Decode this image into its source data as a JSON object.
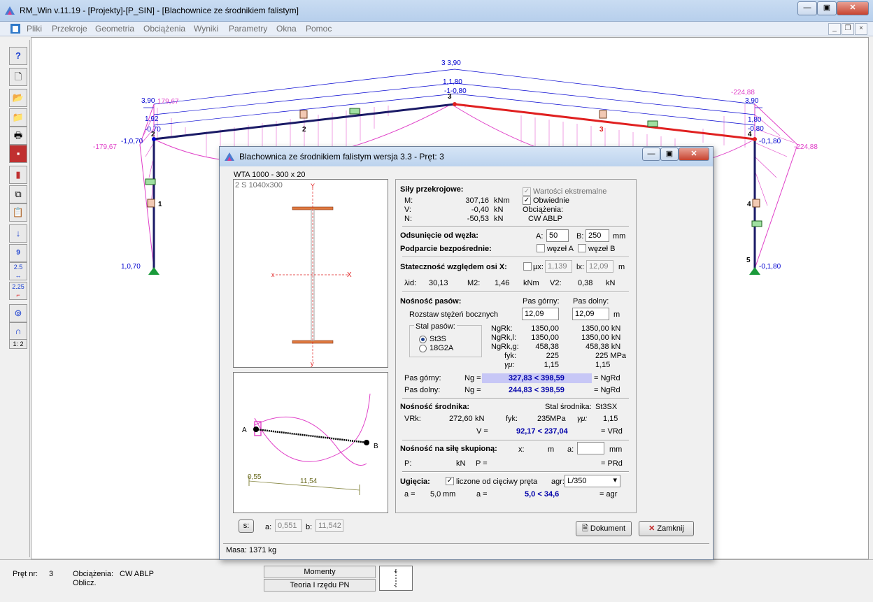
{
  "window": {
    "title": "RM_Win v.11.19 - [Projekty]-[P_SIN] - [Blachownice ze środnikiem falistym]"
  },
  "menu": [
    "Pliki",
    "Przekroje",
    "Geometria",
    "Obciążenia",
    "Wyniki",
    "Parametry",
    "Okna",
    "Pomoc"
  ],
  "toolbar": {
    "icons": [
      "help-icon",
      "new-file-icon",
      "open-folder-icon",
      "open-project-icon",
      "print-icon",
      "save-icon",
      "paint-icon",
      "copy-icon",
      "paste-icon",
      "load-arrow-icon",
      "number-icon",
      "dimension-icon",
      "scale-icon",
      "node-icon",
      "arch-icon",
      "scale-ratio-icon"
    ],
    "num9": "9",
    "dim": "2.5",
    "scale": "2.25",
    "ratio": "1: 2"
  },
  "canvas": {
    "labels_pink": [
      "-179,67",
      "-224,88",
      "-224,88",
      "179,67"
    ],
    "labels_blue": [
      "3 3,90",
      "1,1,80",
      "-1-0,80",
      "3,90",
      "1,92",
      "-0,70",
      "3,90",
      "1,80",
      "-0,80",
      "-1,0,70",
      "-0,1,80",
      "1,0,70",
      "-0,1,80"
    ],
    "bar_numbers": [
      "1",
      "2",
      "3",
      "4",
      "2",
      "2",
      "1",
      "1"
    ],
    "node_numbers": [
      "2",
      "3",
      "4",
      "5"
    ]
  },
  "status": {
    "pret_label": "Pręt nr:",
    "pret_value": "3",
    "obc_label": "Obciążenia:",
    "obc_value": "CW ABLP",
    "oblicz": "Oblicz.",
    "btn_momenty": "Momenty",
    "btn_teoria": "Teoria I rzędu PN"
  },
  "dialog": {
    "title": "Blachownica ze środnikiem falistym wersja 3.3 - Pręt: 3",
    "section": "WTA 1000 - 300 x 20",
    "section_sub": "2 S 1040x300",
    "axes": {
      "y_top": "Y",
      "y_bottom": "y",
      "x_left": "x",
      "x_right": "X"
    },
    "beam": {
      "a_label": "A",
      "b_label": "B",
      "dim1": "0,55",
      "dim2": "11,54"
    },
    "bottom": {
      "s_btn": "s:",
      "a_label": "a:",
      "a_value": "0,551",
      "b_label": "b:",
      "b_value": "11,542"
    },
    "mass": "Masa: 1371 kg",
    "btn_doc": "Dokument",
    "btn_close": "Zamknij",
    "sily": {
      "title": "Siły przekrojowe:",
      "rows": [
        {
          "name": "M:",
          "value": "307,16",
          "unit": "kNm"
        },
        {
          "name": "V:",
          "value": "-0,40",
          "unit": "kN"
        },
        {
          "name": "N:",
          "value": "-50,53",
          "unit": "kN"
        }
      ],
      "chk_ekstremalne": "Wartości ekstremalne",
      "chk_obwiednie": "Obwiednie",
      "obc_label": "Obciążenia:",
      "obc_value": "CW ABLP"
    },
    "odsuniecie": {
      "title": "Odsunięcie od węzła:",
      "a_label": "A:",
      "a_value": "50",
      "b_label": "B:",
      "b_value": "250",
      "unit": "mm"
    },
    "podparcie": {
      "title": "Podparcie bezpośrednie:",
      "a": "węzeł A",
      "b": "węzeł B"
    },
    "statecznosc": {
      "title": "Stateczność względem osi X:",
      "mu_label": "µx:",
      "mu_value": "1,139",
      "l_label": "lx:",
      "l_value": "12,09",
      "unit": "m",
      "lambda_label": "λid:",
      "lambda": "30,13",
      "m2_label": "M2:",
      "m2": "1,46",
      "m2_unit": "kNm",
      "v2_label": "V2:",
      "v2": "0,38",
      "v2_unit": "kN"
    },
    "nosnosc_pasow": {
      "title": "Nośność pasów:",
      "pas_gorny": "Pas górny:",
      "pas_dolny": "Pas dolny:",
      "rozstaw": "Rozstaw stężeń bocznych",
      "rozstaw_g": "12,09",
      "rozstaw_d": "12,09",
      "unit_m": "m",
      "stal": "Stal pasów:",
      "steel1": "St3S",
      "steel2": "18G2A",
      "rows": [
        {
          "name": "NgRk:",
          "g": "1350,00",
          "d": "1350,00 kN"
        },
        {
          "name": "NgRk,l:",
          "g": "1350,00",
          "d": "1350,00 kN"
        },
        {
          "name": "NgRk,g:",
          "g": "458,38",
          "d": "458,38 kN"
        },
        {
          "name": "fyk:",
          "g": "225",
          "d": "225 MPa"
        },
        {
          "name": "γμ:",
          "g": "1,15",
          "d": "1,15"
        }
      ],
      "pg_label": "Pas górny:",
      "pd_label": "Pas dolny:",
      "ng": "Ng =",
      "pg_val": "327,83 < 398,59",
      "pd_val": "244,83 < 398,59",
      "ngrd": "= NgRd"
    },
    "srodnik": {
      "title": "Nośność środnika:",
      "stal": "Stal środnika:",
      "stal_val": "St3SX",
      "vrk_label": "VRk:",
      "vrk": "272,60",
      "vrk_unit": "kN",
      "fyk_label": "fyk:",
      "fyk": "235",
      "fyk_unit": "MPa",
      "gamma_label": "γμ:",
      "gamma": "1,15",
      "v_label": "V =",
      "v_val": "92,17 < 237,04",
      "vrd": "= VRd"
    },
    "skupiona": {
      "title": "Nośność na siłę skupioną:",
      "x_label": "x:",
      "x_unit": "m",
      "a_label": "a:",
      "a_unit": "mm",
      "p_label": "P:",
      "p_unit": "kN",
      "p_eq": "P =",
      "prd": "= PRd"
    },
    "ugiecia": {
      "title": "Ugięcia:",
      "chk": "liczone od cięciwy pręta",
      "agr_label": "agr:",
      "agr_value": "L/350",
      "a_label": "a =",
      "a_val": "5,0",
      "a_unit": "mm",
      "a2_label": "a =",
      "a2_val": "5,0 < 34,6",
      "agr_eq": "= agr"
    }
  }
}
